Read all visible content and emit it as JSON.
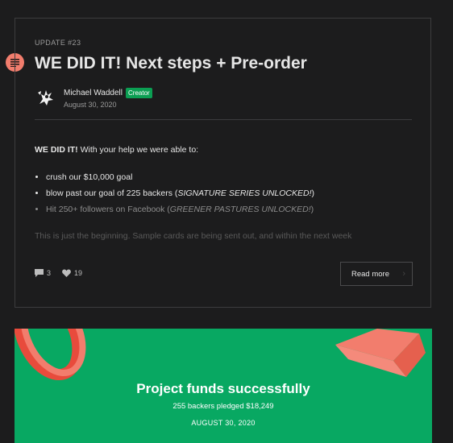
{
  "post": {
    "kicker": "UPDATE #23",
    "title": "WE DID IT! Next steps + Pre-order",
    "author": "Michael Waddell",
    "badge": "Creator",
    "date": "August 30, 2020",
    "intro_bold": "WE DID IT!",
    "intro_rest": " With your help we were able to:",
    "bullets": [
      {
        "pre": "crush our $10,000 goal",
        "em": "",
        "post": ""
      },
      {
        "pre": "blow past our goal of 225 backers (",
        "em": "SIGNATURE SERIES UNLOCKED!",
        "post": ")"
      },
      {
        "pre": "Hit 250+ followers on Facebook (",
        "em": "GREENER PASTURES UNLOCKED!",
        "post": ")"
      }
    ],
    "faded_line": "This is just the beginning. Sample cards are being sent out, and within the next week",
    "comments": "3",
    "likes": "19",
    "read_more": "Read more"
  },
  "banner": {
    "title": "Project funds successfully",
    "subtitle": "255 backers pledged $18,249",
    "date": "AUGUST 30, 2020"
  },
  "colors": {
    "accent": "#f27d6d",
    "creator_badge": "#0b9f53",
    "banner_bg": "#08a862"
  },
  "icons": [
    "menu-lines-icon",
    "comment-icon",
    "heart-icon",
    "arrow-right-icon"
  ]
}
